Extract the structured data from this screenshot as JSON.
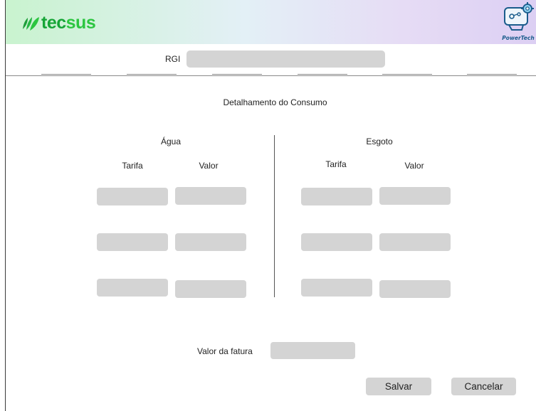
{
  "header": {
    "brand": {
      "part1": "tec",
      "part2": "sus"
    },
    "powertech_logo": "PowerTech",
    "gradient_colors": [
      "#c9f3cf",
      "#e3f0f6",
      "#dccff3"
    ],
    "brand_color": "#16a537"
  },
  "rgi": {
    "label": "RGI",
    "value": ""
  },
  "section": {
    "title": "Detalhamento do Consumo"
  },
  "agua": {
    "title": "Água",
    "col_tarifa": "Tarifa",
    "col_valor": "Valor",
    "rows": [
      {
        "tarifa": "",
        "valor": ""
      },
      {
        "tarifa": "",
        "valor": ""
      },
      {
        "tarifa": "",
        "valor": ""
      }
    ]
  },
  "esgoto": {
    "title": "Esgoto",
    "col_tarifa": "Tarifa",
    "col_valor": "Valor",
    "rows": [
      {
        "tarifa": "",
        "valor": ""
      },
      {
        "tarifa": "",
        "valor": ""
      },
      {
        "tarifa": "",
        "valor": ""
      }
    ]
  },
  "total": {
    "label": "Valor da fatura",
    "value": ""
  },
  "actions": {
    "save": "Salvar",
    "cancel": "Cancelar"
  },
  "colors": {
    "input_bg": "#d4d4d4",
    "text": "#222222"
  }
}
